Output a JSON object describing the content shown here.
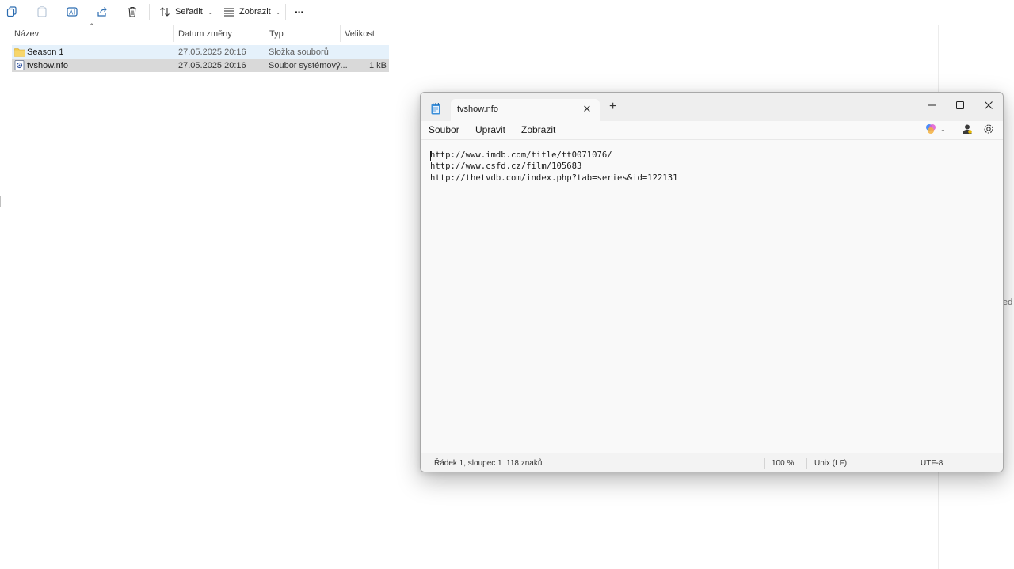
{
  "explorer": {
    "toolbar": {
      "sort_label": "Seřadit",
      "view_label": "Zobrazit",
      "more_label": "···"
    },
    "columns": {
      "name": "Název",
      "date": "Datum změny",
      "type": "Typ",
      "size": "Velikost"
    },
    "files": [
      {
        "name": "Season 1",
        "date": "27.05.2025 20:16",
        "type": "Složka souborů",
        "size": ""
      },
      {
        "name": "tvshow.nfo",
        "date": "27.05.2025 20:16",
        "type": "Soubor systémový...",
        "size": "1 kB"
      }
    ],
    "right_peek_text": "ed r"
  },
  "notepad": {
    "tab_title": "tvshow.nfo",
    "new_tab": "+",
    "menu": {
      "file": "Soubor",
      "edit": "Upravit",
      "view": "Zobrazit"
    },
    "content_lines": [
      "http://www.imdb.com/title/tt0071076/",
      "http://www.csfd.cz/film/105683",
      "http://thetvdb.com/index.php?tab=series&id=122131"
    ],
    "status": {
      "position": "Řádek 1, sloupec 1",
      "chars": "118 znaků",
      "zoom": "100 %",
      "line_ending": "Unix (LF)",
      "encoding": "UTF-8"
    }
  },
  "colors": {
    "folder": "#f2c94c",
    "selection_light": "#e5f1fb",
    "selection_gray": "#d9d9d9",
    "accent_blue": "#0067c0"
  }
}
